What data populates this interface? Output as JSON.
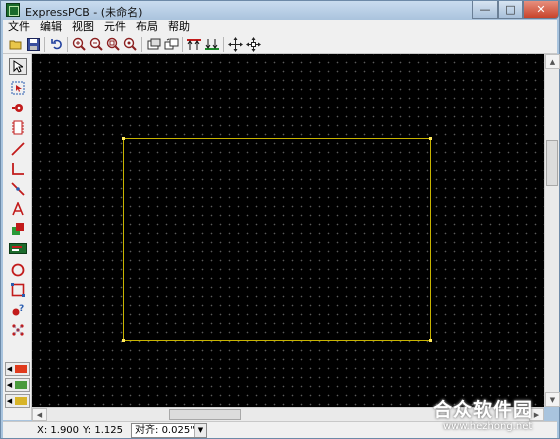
{
  "window": {
    "title": "ExpressPCB - (未命名)",
    "controls": {
      "minimize": "—",
      "maximize": "□",
      "close": "✕"
    }
  },
  "menu": [
    "文件",
    "编辑",
    "视图",
    "元件",
    "布局",
    "帮助"
  ],
  "toolbar": {
    "buttons": [
      {
        "name": "open-icon",
        "glyph": "📂"
      },
      {
        "name": "save-icon",
        "glyph": "💾"
      },
      {
        "name": "undo-icon",
        "glyph": "↶"
      },
      {
        "name": "zoom-in-icon",
        "glyph": "⊕"
      },
      {
        "name": "zoom-out-icon",
        "glyph": "⊖"
      },
      {
        "name": "zoom-window-icon",
        "glyph": "🔍"
      },
      {
        "name": "zoom-fit-icon",
        "glyph": "🔎"
      },
      {
        "name": "component-layer-icon",
        "glyph": "▦"
      },
      {
        "name": "layer-swap-icon",
        "glyph": "⇋"
      },
      {
        "name": "move-up-icon",
        "glyph": "⇈"
      },
      {
        "name": "move-down-icon",
        "glyph": "⇊"
      },
      {
        "name": "pan-icon",
        "glyph": "✥"
      },
      {
        "name": "center-icon",
        "glyph": "⊹"
      }
    ]
  },
  "palette": [
    {
      "name": "select-arrow-icon",
      "glyph": "↖",
      "color": "#000000"
    },
    {
      "name": "group-select-icon",
      "glyph": "⬚",
      "color": "#2a5db0"
    },
    {
      "name": "pad-icon",
      "glyph": "●",
      "color": "#cc0000"
    },
    {
      "name": "component-icon",
      "glyph": "▥",
      "color": "#cc0000"
    },
    {
      "name": "trace-icon",
      "glyph": "╱",
      "color": "#cc0000"
    },
    {
      "name": "corner-trace-icon",
      "glyph": "∟",
      "color": "#cc0000"
    },
    {
      "name": "trace-edit-icon",
      "glyph": "↘",
      "color": "#cc0000"
    },
    {
      "name": "text-icon",
      "glyph": "A",
      "color": "#cc0000"
    },
    {
      "name": "fill-icon",
      "glyph": "▨",
      "color": "#cc0000"
    },
    {
      "name": "board-icon",
      "glyph": "▬",
      "color": "#1c6b2c"
    },
    {
      "name": "circle-icon",
      "glyph": "◯",
      "color": "#cc0000"
    },
    {
      "name": "rectangle-icon",
      "glyph": "⬚",
      "color": "#cc0000"
    },
    {
      "name": "pad-query-icon",
      "glyph": "?",
      "color": "#cc0000"
    },
    {
      "name": "netlist-icon",
      "glyph": "⁂",
      "color": "#cc0000"
    }
  ],
  "layers": [
    {
      "name": "layer-top-copper",
      "color": "#e03a1c"
    },
    {
      "name": "layer-bottom-copper",
      "color": "#4a9a3c"
    },
    {
      "name": "layer-silkscreen",
      "color": "#d8b428"
    }
  ],
  "status": {
    "x": "X: 1.900",
    "y": "Y: 1.125",
    "snap_label": "对齐:",
    "snap_value": "0.025\""
  },
  "watermark": {
    "title": "合众软件园",
    "url": "www.hezhong.net"
  },
  "colors": {
    "canvas": "#000000",
    "board_outline": "#c8b400",
    "grid_dot": "#5a5a5a"
  }
}
